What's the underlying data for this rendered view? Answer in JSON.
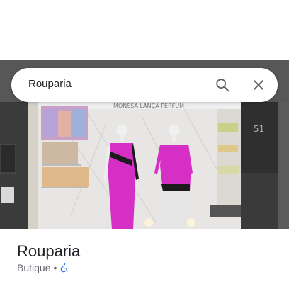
{
  "search": {
    "query": "Rouparia"
  },
  "place": {
    "name": "Rouparia",
    "category": "Butique",
    "separator": "•",
    "accessibility_icon": "wheelchair-icon"
  },
  "colors": {
    "accessibility_blue": "#1a73e8",
    "icon_gray": "#5f6368",
    "dress_magenta": "#d62fc6"
  },
  "photo": {
    "storefront_sign": "... MONSSA ... LANÇA PERFUM",
    "door_number": "51"
  }
}
